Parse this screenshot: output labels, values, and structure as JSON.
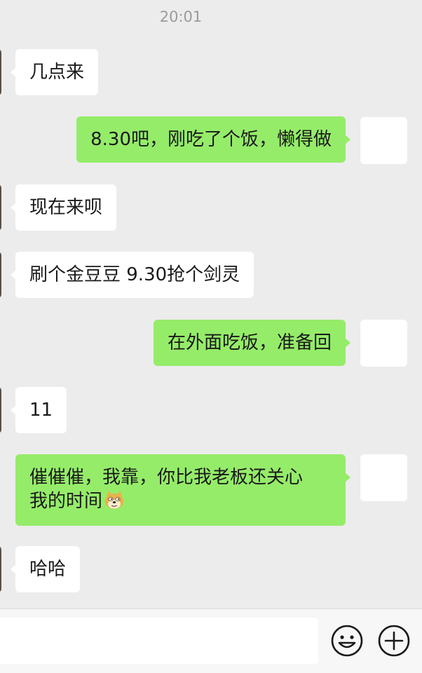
{
  "chat": {
    "timestamp": "20:01",
    "messages": [
      {
        "side": "left",
        "text": "几点来"
      },
      {
        "side": "right",
        "text": "8.30吧，刚吃了个饭，懒得做"
      },
      {
        "side": "left",
        "text": "现在来呗"
      },
      {
        "side": "left",
        "text": "刷个金豆豆 9.30抢个剑灵"
      },
      {
        "side": "right",
        "text": "在外面吃饭，准备回"
      },
      {
        "side": "left",
        "text": "11"
      },
      {
        "side": "right",
        "text_line1": "催催催，我靠，你比我老板还关心",
        "text_line2": "我的时间",
        "emoji": "doge-emoji"
      },
      {
        "side": "left",
        "text": "哈哈"
      }
    ]
  },
  "input_bar": {
    "value": "",
    "emoji_icon": "smiley-face-icon",
    "plus_icon": "plus-circle-icon"
  },
  "colors": {
    "background": "#ececec",
    "bubble_self": "#95ec69",
    "bubble_other": "#ffffff"
  }
}
